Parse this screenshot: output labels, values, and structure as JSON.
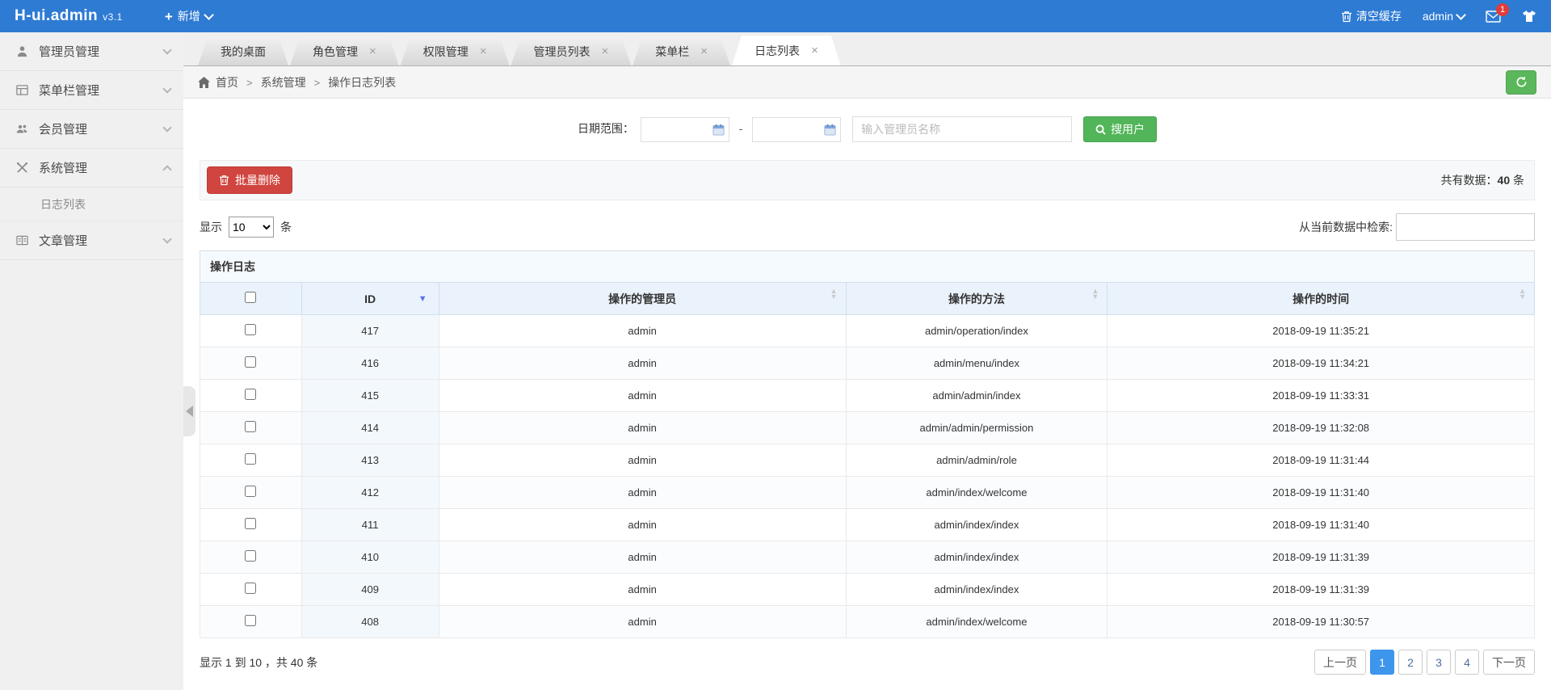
{
  "header": {
    "brand": "H-ui.admin",
    "version": "v3.1",
    "add_label": "新增",
    "clear_cache": "清空缓存",
    "user": "admin",
    "mail_badge": "1"
  },
  "sidebar": {
    "items": [
      {
        "label": "管理员管理",
        "icon": "user-icon",
        "expanded": false
      },
      {
        "label": "菜单栏管理",
        "icon": "window-icon",
        "expanded": false
      },
      {
        "label": "会员管理",
        "icon": "users-icon",
        "expanded": false
      },
      {
        "label": "系统管理",
        "icon": "tools-icon",
        "expanded": true,
        "children": [
          {
            "label": "日志列表",
            "active": true
          }
        ]
      },
      {
        "label": "文章管理",
        "icon": "article-icon",
        "expanded": false
      }
    ]
  },
  "tabs": {
    "items": [
      {
        "label": "我的桌面",
        "closable": false,
        "active": false
      },
      {
        "label": "角色管理",
        "closable": true,
        "active": false
      },
      {
        "label": "权限管理",
        "closable": true,
        "active": false
      },
      {
        "label": "管理员列表",
        "closable": true,
        "active": false
      },
      {
        "label": "菜单栏",
        "closable": true,
        "active": false
      },
      {
        "label": "日志列表",
        "closable": true,
        "active": true
      }
    ]
  },
  "breadcrumb": {
    "items": [
      "首页",
      "系统管理",
      "操作日志列表"
    ],
    "separator": ">"
  },
  "search": {
    "date_label": "日期范围：",
    "date_from": "",
    "date_to": "",
    "dash": "-",
    "name_placeholder": "输入管理员名称",
    "button_label": "搜用户"
  },
  "toolbar": {
    "batch_delete_label": "批量删除",
    "total_prefix": "共有数据：",
    "total_count": "40",
    "total_unit": "条"
  },
  "display": {
    "show_label": "显示",
    "page_size": "10",
    "unit_label": "条",
    "filter_label": "从当前数据中检索:",
    "filter_value": ""
  },
  "table": {
    "caption": "操作日志",
    "columns": [
      "ID",
      "操作的管理员",
      "操作的方法",
      "操作的时间"
    ],
    "rows": [
      {
        "id": "417",
        "admin": "admin",
        "method": "admin/operation/index",
        "time": "2018-09-19 11:35:21"
      },
      {
        "id": "416",
        "admin": "admin",
        "method": "admin/menu/index",
        "time": "2018-09-19 11:34:21"
      },
      {
        "id": "415",
        "admin": "admin",
        "method": "admin/admin/index",
        "time": "2018-09-19 11:33:31"
      },
      {
        "id": "414",
        "admin": "admin",
        "method": "admin/admin/permission",
        "time": "2018-09-19 11:32:08"
      },
      {
        "id": "413",
        "admin": "admin",
        "method": "admin/admin/role",
        "time": "2018-09-19 11:31:44"
      },
      {
        "id": "412",
        "admin": "admin",
        "method": "admin/index/welcome",
        "time": "2018-09-19 11:31:40"
      },
      {
        "id": "411",
        "admin": "admin",
        "method": "admin/index/index",
        "time": "2018-09-19 11:31:40"
      },
      {
        "id": "410",
        "admin": "admin",
        "method": "admin/index/index",
        "time": "2018-09-19 11:31:39"
      },
      {
        "id": "409",
        "admin": "admin",
        "method": "admin/index/index",
        "time": "2018-09-19 11:31:39"
      },
      {
        "id": "408",
        "admin": "admin",
        "method": "admin/index/welcome",
        "time": "2018-09-19 11:30:57"
      }
    ]
  },
  "pagination": {
    "info": "显示 1 到 10 ，共 40 条",
    "prev_label": "上一页",
    "pages": [
      "1",
      "2",
      "3",
      "4"
    ],
    "active_page": "1",
    "next_label": "下一页"
  },
  "colors": {
    "header_bg": "#2e7bd4",
    "green": "#52b559",
    "red": "#d0453f",
    "active_page_bg": "#3d95ec",
    "table_head_bg": "#eaf2fb",
    "id_column_bg": "#f3f8fd"
  }
}
